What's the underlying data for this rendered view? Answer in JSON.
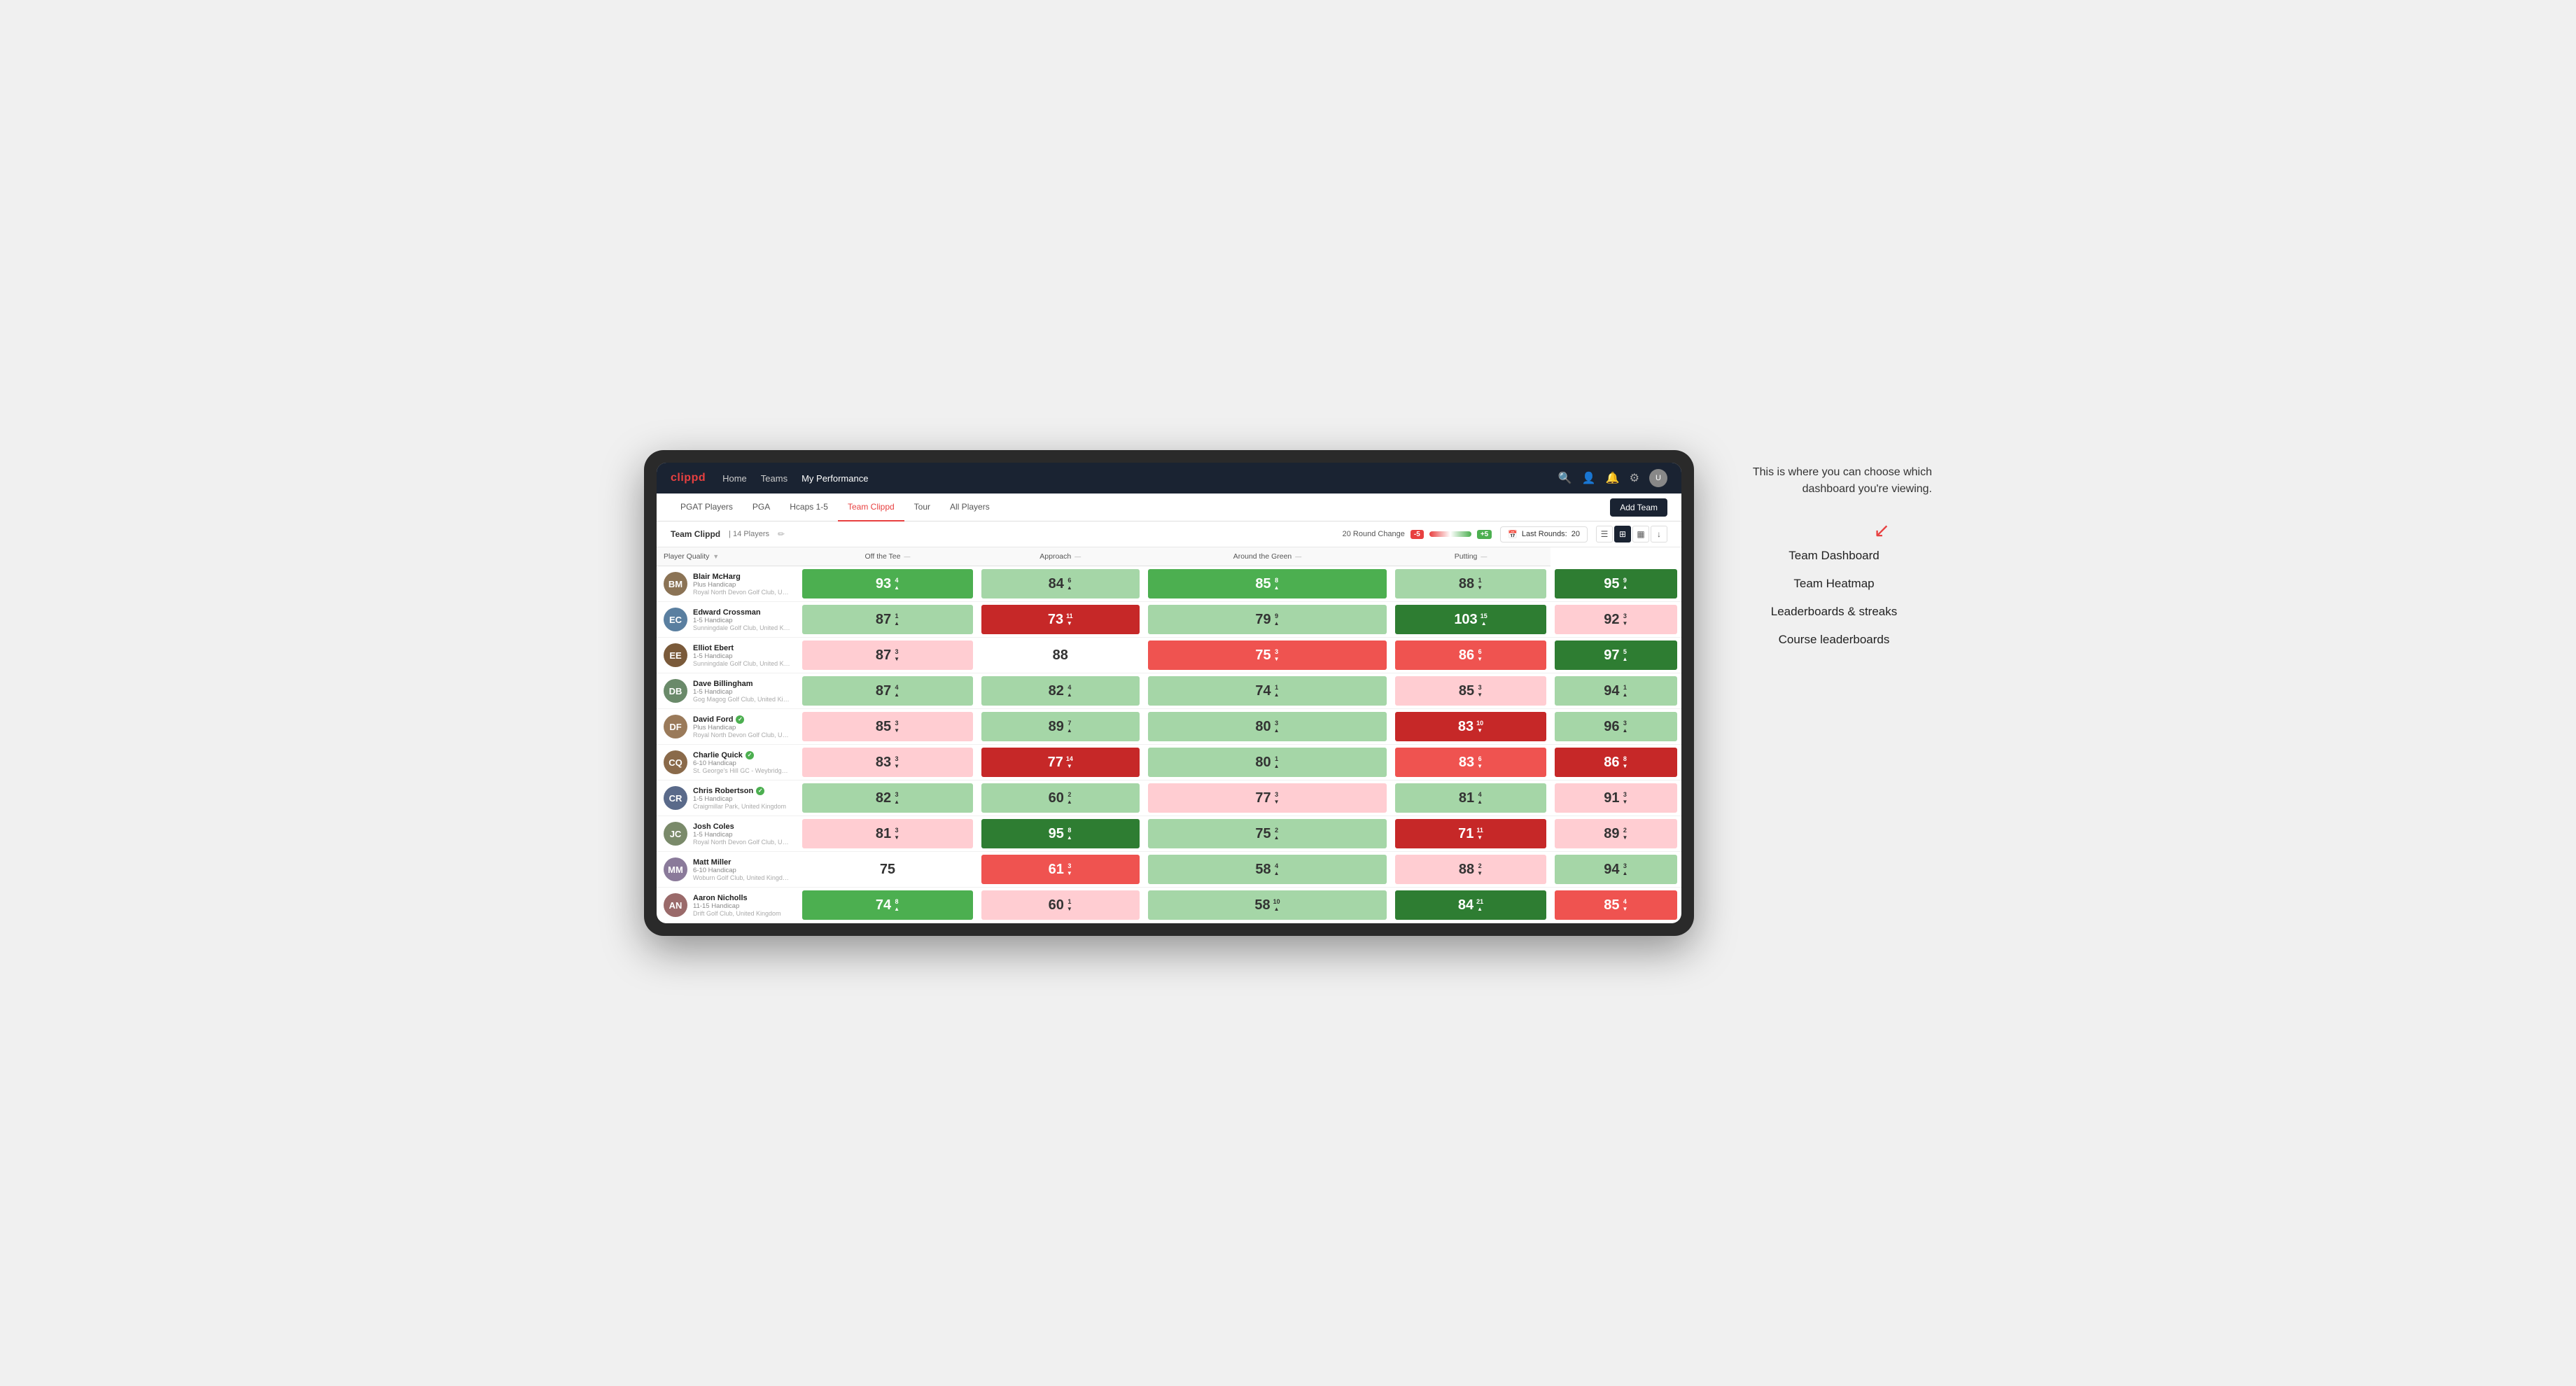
{
  "annotation": {
    "description": "This is where you can choose which dashboard you're viewing.",
    "items": [
      "Team Dashboard",
      "Team Heatmap",
      "Leaderboards & streaks",
      "Course leaderboards"
    ]
  },
  "nav": {
    "logo": "clippd",
    "links": [
      "Home",
      "Teams",
      "My Performance"
    ],
    "icons": [
      "search",
      "person",
      "bell",
      "settings",
      "avatar"
    ]
  },
  "sub_nav": {
    "links": [
      "PGAT Players",
      "PGA",
      "Hcaps 1-5",
      "Team Clippd",
      "Tour",
      "All Players"
    ],
    "active": "Team Clippd",
    "add_button": "Add Team"
  },
  "team_bar": {
    "name": "Team Clippd",
    "separator": "|",
    "count": "14 Players",
    "round_change_label": "20 Round Change",
    "minus": "-5",
    "plus": "+5",
    "last_rounds_label": "Last Rounds:",
    "last_rounds_value": "20"
  },
  "table": {
    "headers": {
      "player": "Player Quality",
      "off_tee": "Off the Tee",
      "approach": "Approach",
      "around_green": "Around the Green",
      "putting": "Putting"
    },
    "players": [
      {
        "name": "Blair McHarg",
        "handicap": "Plus Handicap",
        "club": "Royal North Devon Golf Club, United Kingdom",
        "avatar_color": "#8B6914",
        "initials": "BM",
        "scores": {
          "quality": {
            "value": 93,
            "change": 4,
            "dir": "up",
            "color": "green-mid"
          },
          "off_tee": {
            "value": 84,
            "change": 6,
            "dir": "up",
            "color": "green-light"
          },
          "approach": {
            "value": 85,
            "change": 8,
            "dir": "up",
            "color": "green-mid"
          },
          "around_green": {
            "value": 88,
            "change": 1,
            "dir": "down",
            "color": "green-light"
          },
          "putting": {
            "value": 95,
            "change": 9,
            "dir": "up",
            "color": "green-dark"
          }
        }
      },
      {
        "name": "Edward Crossman",
        "handicap": "1-5 Handicap",
        "club": "Sunningdale Golf Club, United Kingdom",
        "avatar_color": "#5a7fa0",
        "initials": "EC",
        "scores": {
          "quality": {
            "value": 87,
            "change": 1,
            "dir": "up",
            "color": "green-light"
          },
          "off_tee": {
            "value": 73,
            "change": 11,
            "dir": "down",
            "color": "red-dark"
          },
          "approach": {
            "value": 79,
            "change": 9,
            "dir": "up",
            "color": "green-light"
          },
          "around_green": {
            "value": 103,
            "change": 15,
            "dir": "up",
            "color": "green-dark"
          },
          "putting": {
            "value": 92,
            "change": 3,
            "dir": "down",
            "color": "red-light"
          }
        }
      },
      {
        "name": "Elliot Ebert",
        "handicap": "1-5 Handicap",
        "club": "Sunningdale Golf Club, United Kingdom",
        "avatar_color": "#7a5a3a",
        "initials": "EE",
        "scores": {
          "quality": {
            "value": 87,
            "change": 3,
            "dir": "down",
            "color": "red-light"
          },
          "off_tee": {
            "value": 88,
            "change": 0,
            "dir": "none",
            "color": "white-cell"
          },
          "approach": {
            "value": 75,
            "change": 3,
            "dir": "down",
            "color": "red-mid"
          },
          "around_green": {
            "value": 86,
            "change": 6,
            "dir": "down",
            "color": "red-mid"
          },
          "putting": {
            "value": 97,
            "change": 5,
            "dir": "up",
            "color": "green-dark"
          }
        }
      },
      {
        "name": "Dave Billingham",
        "handicap": "1-5 Handicap",
        "club": "Gog Magog Golf Club, United Kingdom",
        "avatar_color": "#6a8a6a",
        "initials": "DB",
        "scores": {
          "quality": {
            "value": 87,
            "change": 4,
            "dir": "up",
            "color": "green-light"
          },
          "off_tee": {
            "value": 82,
            "change": 4,
            "dir": "up",
            "color": "green-light"
          },
          "approach": {
            "value": 74,
            "change": 1,
            "dir": "up",
            "color": "green-light"
          },
          "around_green": {
            "value": 85,
            "change": 3,
            "dir": "down",
            "color": "red-light"
          },
          "putting": {
            "value": 94,
            "change": 1,
            "dir": "up",
            "color": "green-light"
          }
        }
      },
      {
        "name": "David Ford",
        "handicap": "Plus Handicap",
        "club": "Royal North Devon Golf Club, United Kingdom",
        "avatar_color": "#9a7a5a",
        "initials": "DF",
        "verified": true,
        "scores": {
          "quality": {
            "value": 85,
            "change": 3,
            "dir": "down",
            "color": "red-light"
          },
          "off_tee": {
            "value": 89,
            "change": 7,
            "dir": "up",
            "color": "green-light"
          },
          "approach": {
            "value": 80,
            "change": 3,
            "dir": "up",
            "color": "green-light"
          },
          "around_green": {
            "value": 83,
            "change": 10,
            "dir": "down",
            "color": "red-dark"
          },
          "putting": {
            "value": 96,
            "change": 3,
            "dir": "up",
            "color": "green-light"
          }
        }
      },
      {
        "name": "Charlie Quick",
        "handicap": "6-10 Handicap",
        "club": "St. George's Hill GC - Weybridge - Surrey, Uni...",
        "avatar_color": "#8a6a4a",
        "initials": "CQ",
        "verified": true,
        "scores": {
          "quality": {
            "value": 83,
            "change": 3,
            "dir": "down",
            "color": "red-light"
          },
          "off_tee": {
            "value": 77,
            "change": 14,
            "dir": "down",
            "color": "red-dark"
          },
          "approach": {
            "value": 80,
            "change": 1,
            "dir": "up",
            "color": "green-light"
          },
          "around_green": {
            "value": 83,
            "change": 6,
            "dir": "down",
            "color": "red-mid"
          },
          "putting": {
            "value": 86,
            "change": 8,
            "dir": "down",
            "color": "red-dark"
          }
        }
      },
      {
        "name": "Chris Robertson",
        "handicap": "1-5 Handicap",
        "club": "Craigmillar Park, United Kingdom",
        "avatar_color": "#5a6a8a",
        "initials": "CR",
        "verified": true,
        "scores": {
          "quality": {
            "value": 82,
            "change": 3,
            "dir": "up",
            "color": "green-light"
          },
          "off_tee": {
            "value": 60,
            "change": 2,
            "dir": "up",
            "color": "green-light"
          },
          "approach": {
            "value": 77,
            "change": 3,
            "dir": "down",
            "color": "red-light"
          },
          "around_green": {
            "value": 81,
            "change": 4,
            "dir": "up",
            "color": "green-light"
          },
          "putting": {
            "value": 91,
            "change": 3,
            "dir": "down",
            "color": "red-light"
          }
        }
      },
      {
        "name": "Josh Coles",
        "handicap": "1-5 Handicap",
        "club": "Royal North Devon Golf Club, United Kingdom",
        "avatar_color": "#7a8a6a",
        "initials": "JC",
        "scores": {
          "quality": {
            "value": 81,
            "change": 3,
            "dir": "down",
            "color": "red-light"
          },
          "off_tee": {
            "value": 95,
            "change": 8,
            "dir": "up",
            "color": "green-dark"
          },
          "approach": {
            "value": 75,
            "change": 2,
            "dir": "up",
            "color": "green-light"
          },
          "around_green": {
            "value": 71,
            "change": 11,
            "dir": "down",
            "color": "red-dark"
          },
          "putting": {
            "value": 89,
            "change": 2,
            "dir": "down",
            "color": "red-light"
          }
        }
      },
      {
        "name": "Matt Miller",
        "handicap": "6-10 Handicap",
        "club": "Woburn Golf Club, United Kingdom",
        "avatar_color": "#8a7a9a",
        "initials": "MM",
        "scores": {
          "quality": {
            "value": 75,
            "change": 0,
            "dir": "none",
            "color": "white-cell"
          },
          "off_tee": {
            "value": 61,
            "change": 3,
            "dir": "down",
            "color": "red-mid"
          },
          "approach": {
            "value": 58,
            "change": 4,
            "dir": "up",
            "color": "green-light"
          },
          "around_green": {
            "value": 88,
            "change": 2,
            "dir": "down",
            "color": "red-light"
          },
          "putting": {
            "value": 94,
            "change": 3,
            "dir": "up",
            "color": "green-light"
          }
        }
      },
      {
        "name": "Aaron Nicholls",
        "handicap": "11-15 Handicap",
        "club": "Drift Golf Club, United Kingdom",
        "avatar_color": "#9a6a6a",
        "initials": "AN",
        "scores": {
          "quality": {
            "value": 74,
            "change": 8,
            "dir": "up",
            "color": "green-mid"
          },
          "off_tee": {
            "value": 60,
            "change": 1,
            "dir": "down",
            "color": "red-light"
          },
          "approach": {
            "value": 58,
            "change": 10,
            "dir": "up",
            "color": "green-light"
          },
          "around_green": {
            "value": 84,
            "change": 21,
            "dir": "up",
            "color": "green-dark"
          },
          "putting": {
            "value": 85,
            "change": 4,
            "dir": "down",
            "color": "red-mid"
          }
        }
      }
    ]
  },
  "colors": {
    "green_dark": "#2e7d32",
    "green_mid": "#4caf50",
    "green_light": "#a5d6a7",
    "red_dark": "#c62828",
    "red_mid": "#ef5350",
    "red_light": "#ffcdd2",
    "white": "#ffffff",
    "nav_bg": "#1a2332",
    "accent": "#e84040"
  }
}
